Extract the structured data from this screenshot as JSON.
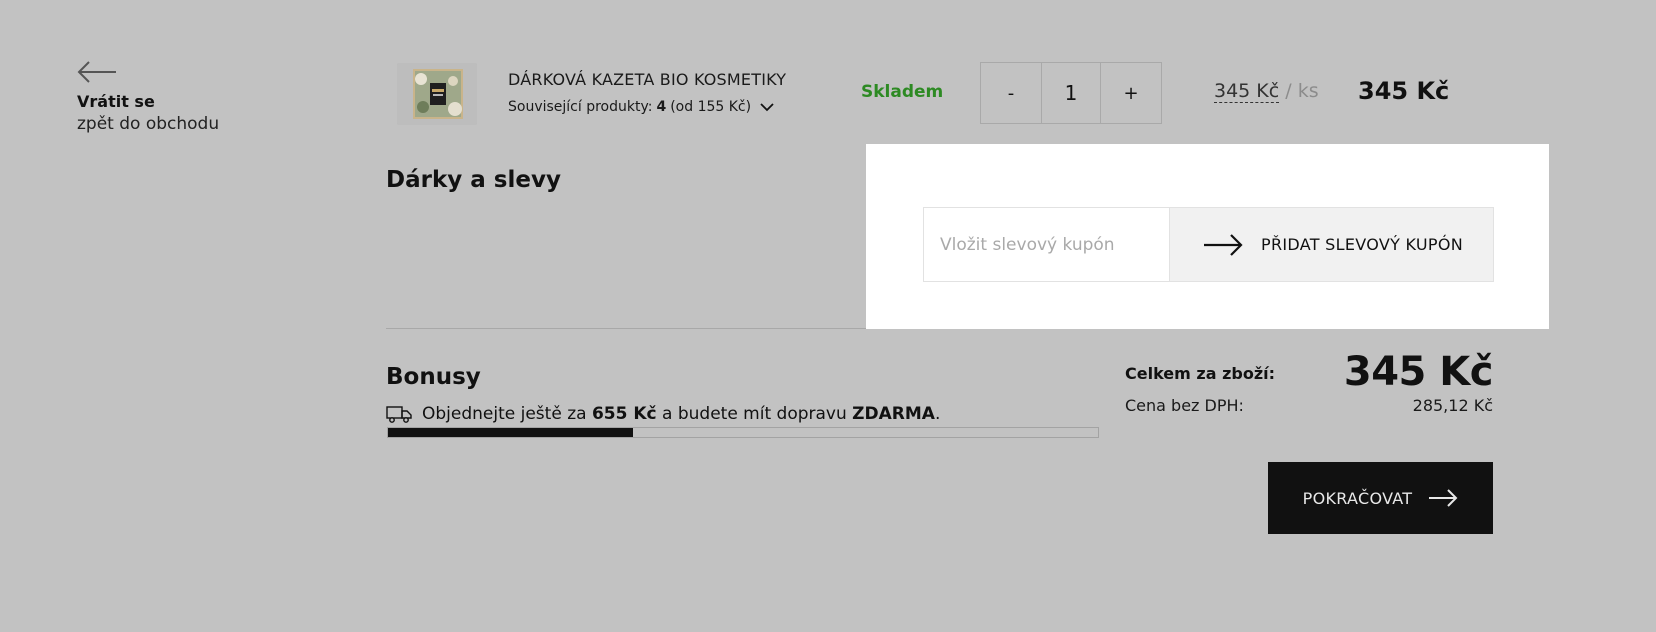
{
  "back": {
    "title": "Vrátit se",
    "subtitle": "zpět do obchodu"
  },
  "product": {
    "name": "DÁRKOVÁ KAZETA BIO KOSMETIKY",
    "related_label": "Související produkty:",
    "related_count": "4",
    "related_from": "(od 155 Kč)",
    "stock": "Skladem",
    "qty_minus": "-",
    "qty_value": "1",
    "qty_plus": "+",
    "unit_price": "345 Kč",
    "unit_sep": " / ",
    "unit_per": "ks",
    "line_total": "345 Kč"
  },
  "gifts": {
    "title": "Dárky a slevy",
    "coupon_placeholder": "Vložit slevový kupón",
    "coupon_button": "PŘIDAT SLEVOVÝ KUPÓN"
  },
  "bonus": {
    "title": "Bonusy",
    "text_before": "Objednejte ještě za",
    "amount": "655 Kč",
    "text_middle": "a budete mít dopravu",
    "free": "ZDARMA",
    "text_end": ".",
    "progress_fraction": 0.345
  },
  "summary": {
    "total_label": "Celkem za zboží:",
    "total_value": "345 Kč",
    "net_label": "Cena bez DPH:",
    "net_value": "285,12 Kč"
  },
  "continue_label": "POKRAČOVAT",
  "colors": {
    "stock_green": "#2d8a23",
    "background": "#c2c2c2",
    "button_dark": "#111111"
  },
  "icons": {
    "back": "arrow-left-icon",
    "related": "chevron-down-icon",
    "coupon": "arrow-right-icon",
    "shipping": "truck-icon",
    "continue": "arrow-right-icon"
  }
}
